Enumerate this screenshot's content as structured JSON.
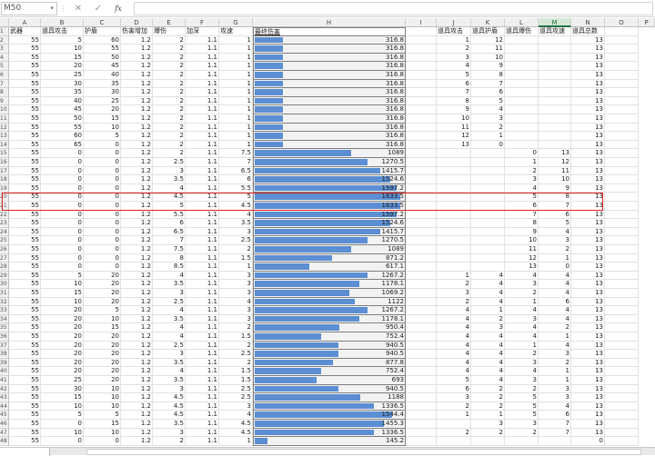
{
  "formula_bar": {
    "name_box": "M50",
    "cancel_icon": "✕",
    "enter_icon": "✓",
    "fx_label": "fx",
    "formula": ""
  },
  "columns": [
    "A",
    "B",
    "C",
    "D",
    "E",
    "F",
    "G",
    "H",
    "I",
    "J",
    "K",
    "L",
    "M",
    "N",
    "O"
  ],
  "selected_column": "M",
  "headers": [
    "武器",
    "道具攻击",
    "护盾",
    "伤害增加",
    "爆伤",
    "加深",
    "攻速",
    "最终伤害",
    "",
    "道具攻击",
    "道具护盾",
    "道具爆伤",
    "道具攻速",
    "道具总数",
    ""
  ],
  "highlight_rows": [
    20,
    21
  ],
  "colors": {
    "bar": "#5b8ed3",
    "highlight": "#e02020",
    "selected_header": "#217346"
  },
  "bar_scale_max": 1700,
  "rows": [
    [
      "2",
      "55",
      "5",
      "60",
      "1.2",
      "2",
      "1.1",
      "1",
      "316.8",
      "",
      "1",
      "12",
      "",
      "",
      "13"
    ],
    [
      "3",
      "55",
      "10",
      "55",
      "1.2",
      "2",
      "1.1",
      "1",
      "316.8",
      "",
      "2",
      "11",
      "",
      "",
      "13"
    ],
    [
      "4",
      "55",
      "15",
      "50",
      "1.2",
      "2",
      "1.1",
      "1",
      "316.8",
      "",
      "3",
      "10",
      "",
      "",
      "13"
    ],
    [
      "5",
      "55",
      "20",
      "45",
      "1.2",
      "2",
      "1.1",
      "1",
      "316.8",
      "",
      "4",
      "9",
      "",
      "",
      "13"
    ],
    [
      "6",
      "55",
      "25",
      "40",
      "1.2",
      "2",
      "1.1",
      "1",
      "316.8",
      "",
      "5",
      "8",
      "",
      "",
      "13"
    ],
    [
      "7",
      "55",
      "30",
      "35",
      "1.2",
      "2",
      "1.1",
      "1",
      "316.8",
      "",
      "6",
      "7",
      "",
      "",
      "13"
    ],
    [
      "8",
      "55",
      "35",
      "30",
      "1.2",
      "2",
      "1.1",
      "1",
      "316.8",
      "",
      "7",
      "6",
      "",
      "",
      "13"
    ],
    [
      "9",
      "55",
      "40",
      "25",
      "1.2",
      "2",
      "1.1",
      "1",
      "316.8",
      "",
      "8",
      "5",
      "",
      "",
      "13"
    ],
    [
      "10",
      "55",
      "45",
      "20",
      "1.2",
      "2",
      "1.1",
      "1",
      "316.8",
      "",
      "9",
      "4",
      "",
      "",
      "13"
    ],
    [
      "11",
      "55",
      "50",
      "15",
      "1.2",
      "2",
      "1.1",
      "1",
      "316.8",
      "",
      "10",
      "3",
      "",
      "",
      "13"
    ],
    [
      "12",
      "55",
      "55",
      "10",
      "1.2",
      "2",
      "1.1",
      "1",
      "316.8",
      "",
      "11",
      "2",
      "",
      "",
      "13"
    ],
    [
      "13",
      "55",
      "60",
      "5",
      "1.2",
      "2",
      "1.1",
      "1",
      "316.8",
      "",
      "12",
      "1",
      "",
      "",
      "13"
    ],
    [
      "14",
      "55",
      "65",
      "0",
      "1.2",
      "2",
      "1.1",
      "1",
      "316.8",
      "",
      "13",
      "0",
      "",
      "",
      "13"
    ],
    [
      "15",
      "55",
      "0",
      "0",
      "1.2",
      "2",
      "1.1",
      "7.5",
      "1089",
      "",
      "",
      "",
      "0",
      "13",
      "13"
    ],
    [
      "16",
      "55",
      "0",
      "0",
      "1.2",
      "2.5",
      "1.1",
      "7",
      "1270.5",
      "",
      "",
      "",
      "1",
      "12",
      "13"
    ],
    [
      "17",
      "55",
      "0",
      "0",
      "1.2",
      "3",
      "1.1",
      "6.5",
      "1415.7",
      "",
      "",
      "",
      "2",
      "11",
      "13"
    ],
    [
      "18",
      "55",
      "0",
      "0",
      "1.2",
      "3.5",
      "1.1",
      "6",
      "1524.6",
      "",
      "",
      "",
      "3",
      "10",
      "13"
    ],
    [
      "19",
      "55",
      "0",
      "0",
      "1.2",
      "4",
      "1.1",
      "5.5",
      "1597.2",
      "",
      "",
      "",
      "4",
      "9",
      "13"
    ],
    [
      "20",
      "55",
      "0",
      "0",
      "1.2",
      "4.5",
      "1.1",
      "5",
      "1633.5",
      "",
      "",
      "",
      "5",
      "8",
      "13"
    ],
    [
      "21",
      "55",
      "0",
      "0",
      "1.2",
      "5",
      "1.1",
      "4.5",
      "1633.5",
      "",
      "",
      "",
      "6",
      "7",
      "13"
    ],
    [
      "22",
      "55",
      "0",
      "0",
      "1.2",
      "5.5",
      "1.1",
      "4",
      "1597.2",
      "",
      "",
      "",
      "7",
      "6",
      "13"
    ],
    [
      "23",
      "55",
      "0",
      "0",
      "1.2",
      "6",
      "1.1",
      "3.5",
      "1524.6",
      "",
      "",
      "",
      "8",
      "5",
      "13"
    ],
    [
      "24",
      "55",
      "0",
      "0",
      "1.2",
      "6.5",
      "1.1",
      "3",
      "1415.7",
      "",
      "",
      "",
      "9",
      "4",
      "13"
    ],
    [
      "25",
      "55",
      "0",
      "0",
      "1.2",
      "7",
      "1.1",
      "2.5",
      "1270.5",
      "",
      "",
      "",
      "10",
      "3",
      "13"
    ],
    [
      "26",
      "55",
      "0",
      "0",
      "1.2",
      "7.5",
      "1.1",
      "2",
      "1089",
      "",
      "",
      "",
      "11",
      "2",
      "13"
    ],
    [
      "27",
      "55",
      "0",
      "0",
      "1.2",
      "8",
      "1.1",
      "1.5",
      "871.2",
      "",
      "",
      "",
      "12",
      "1",
      "13"
    ],
    [
      "28",
      "55",
      "0",
      "0",
      "1.2",
      "8.5",
      "1.1",
      "1",
      "617.1",
      "",
      "",
      "",
      "13",
      "0",
      "13"
    ],
    [
      "29",
      "55",
      "5",
      "20",
      "1.2",
      "4",
      "1.1",
      "3",
      "1267.2",
      "",
      "1",
      "4",
      "4",
      "4",
      "13"
    ],
    [
      "30",
      "55",
      "10",
      "20",
      "1.2",
      "3.5",
      "1.1",
      "3",
      "1178.1",
      "",
      "2",
      "4",
      "3",
      "4",
      "13"
    ],
    [
      "31",
      "55",
      "15",
      "20",
      "1.2",
      "3",
      "1.1",
      "3",
      "1069.2",
      "",
      "3",
      "4",
      "2",
      "4",
      "13"
    ],
    [
      "32",
      "55",
      "10",
      "20",
      "1.2",
      "2.5",
      "1.1",
      "4",
      "1122",
      "",
      "2",
      "4",
      "1",
      "6",
      "13"
    ],
    [
      "33",
      "55",
      "20",
      "5",
      "1.2",
      "4",
      "1.1",
      "3",
      "1267.2",
      "",
      "4",
      "1",
      "4",
      "4",
      "13"
    ],
    [
      "34",
      "55",
      "20",
      "10",
      "1.2",
      "3.5",
      "1.1",
      "3",
      "1178.1",
      "",
      "4",
      "2",
      "3",
      "4",
      "13"
    ],
    [
      "35",
      "55",
      "20",
      "15",
      "1.2",
      "4",
      "1.1",
      "2",
      "950.4",
      "",
      "4",
      "3",
      "4",
      "2",
      "13"
    ],
    [
      "36",
      "55",
      "20",
      "20",
      "1.2",
      "4",
      "1.1",
      "1.5",
      "752.4",
      "",
      "4",
      "4",
      "4",
      "1",
      "13"
    ],
    [
      "37",
      "55",
      "20",
      "20",
      "1.2",
      "2.5",
      "1.1",
      "2",
      "940.5",
      "",
      "4",
      "4",
      "1",
      "4",
      "13"
    ],
    [
      "38",
      "55",
      "20",
      "20",
      "1.2",
      "3",
      "1.1",
      "2.5",
      "940.5",
      "",
      "4",
      "4",
      "2",
      "3",
      "13"
    ],
    [
      "39",
      "55",
      "20",
      "20",
      "1.2",
      "3.5",
      "1.1",
      "2",
      "877.8",
      "",
      "4",
      "4",
      "3",
      "2",
      "13"
    ],
    [
      "40",
      "55",
      "20",
      "20",
      "1.2",
      "4",
      "1.1",
      "1.5",
      "752.4",
      "",
      "4",
      "4",
      "4",
      "1",
      "13"
    ],
    [
      "41",
      "55",
      "25",
      "20",
      "1.2",
      "3.5",
      "1.1",
      "1.5",
      "693",
      "",
      "5",
      "4",
      "3",
      "1",
      "13"
    ],
    [
      "42",
      "55",
      "30",
      "10",
      "1.2",
      "3",
      "1.1",
      "2.5",
      "940.5",
      "",
      "6",
      "2",
      "2",
      "3",
      "13"
    ],
    [
      "43",
      "55",
      "15",
      "10",
      "1.2",
      "4.5",
      "1.1",
      "2.5",
      "1188",
      "",
      "3",
      "2",
      "5",
      "3",
      "13"
    ],
    [
      "44",
      "55",
      "10",
      "10",
      "1.2",
      "4.5",
      "1.1",
      "3",
      "1336.5",
      "",
      "2",
      "2",
      "5",
      "4",
      "13"
    ],
    [
      "45",
      "55",
      "5",
      "5",
      "1.2",
      "4.5",
      "1.1",
      "4",
      "1544.4",
      "",
      "1",
      "1",
      "5",
      "6",
      "13"
    ],
    [
      "46",
      "55",
      "0",
      "15",
      "1.2",
      "3.5",
      "1.1",
      "4.5",
      "1455.3",
      "",
      "",
      "3",
      "3",
      "7",
      "13"
    ],
    [
      "47",
      "55",
      "10",
      "10",
      "1.2",
      "3",
      "1.1",
      "4.5",
      "1336.5",
      "",
      "2",
      "2",
      "2",
      "7",
      "13"
    ],
    [
      "48",
      "55",
      "0",
      "0",
      "1.2",
      "2",
      "1.1",
      "1",
      "145.2",
      "",
      "",
      "",
      "",
      "",
      "0"
    ]
  ]
}
